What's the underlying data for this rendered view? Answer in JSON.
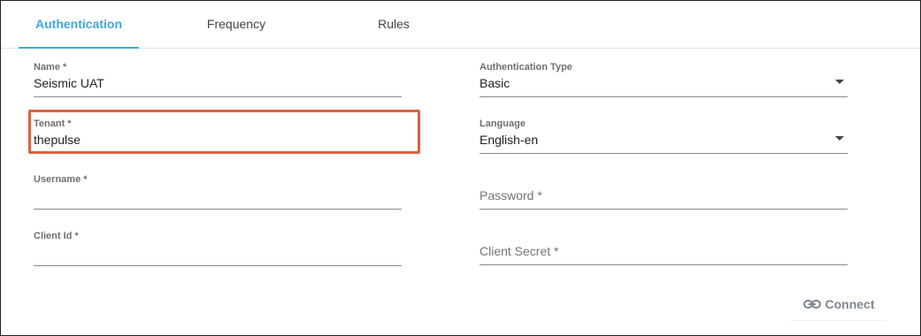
{
  "tabs": [
    {
      "label": "Authentication",
      "active": true
    },
    {
      "label": "Frequency",
      "active": false
    },
    {
      "label": "Rules",
      "active": false
    }
  ],
  "form": {
    "name": {
      "label": "Name *",
      "value": "Seismic UAT"
    },
    "authentication_type": {
      "label": "Authentication Type",
      "value": "Basic"
    },
    "tenant": {
      "label": "Tenant *",
      "value": "thepulse"
    },
    "language": {
      "label": "Language",
      "value": "English-en"
    },
    "username": {
      "label": "Username *",
      "value": ""
    },
    "password": {
      "placeholder": "Password *",
      "value": ""
    },
    "client_id": {
      "label": "Client Id *",
      "value": ""
    },
    "client_secret": {
      "placeholder": "Client Secret *",
      "value": ""
    }
  },
  "actions": {
    "connect_label": "Connect",
    "connect_icon": "link-icon"
  },
  "colors": {
    "accent": "#3da9e0",
    "highlight": "#d9613d",
    "button_text": "#7d8791"
  }
}
